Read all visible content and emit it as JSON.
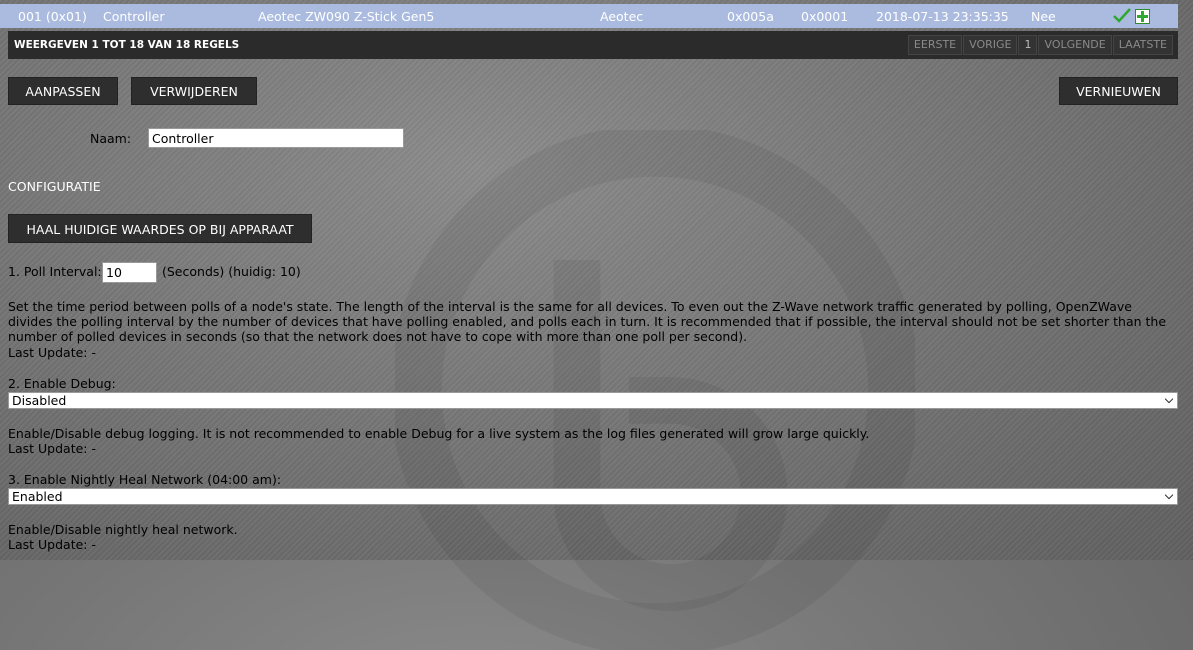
{
  "selected_row": {
    "node_id": "001 (0x01)",
    "name": "Controller",
    "description": "Aeotec ZW090 Z-Stick Gen5",
    "manufacturer": "Aeotec",
    "product_id": "0x005a",
    "product_type": "0x0001",
    "last_seen": "2018-07-13 23:35:35",
    "state": "Nee"
  },
  "table_footer": {
    "info": "WEERGEVEN 1 TOT 18 VAN 18 REGELS",
    "pager": {
      "first": "EERSTE",
      "previous": "VORIGE",
      "current": "1",
      "next": "VOLGENDE",
      "last": "LAATSTE"
    }
  },
  "actions": {
    "edit": "AANPASSEN",
    "delete": "VERWIJDEREN",
    "refresh": "VERNIEUWEN"
  },
  "name_field": {
    "label": "Naam:",
    "value": "Controller"
  },
  "config": {
    "title": "CONFIGURATIE",
    "fetch_button": "HAAL HUIDIGE WAARDES OP BIJ APPARAAT",
    "items": [
      {
        "label": "1. Poll Interval:",
        "value": "10",
        "unit": "(Seconds) (huidig: 10)",
        "description": "Set the time period between polls of a node's state. The length of the interval is the same for all devices. To even out the Z-Wave network traffic generated by polling, OpenZWave divides the polling interval by the number of devices that have polling enabled, and polls each in turn. It is recommended that if possible, the interval should not be set shorter than the number of polled devices in seconds (so that the network does not have to cope with more than one poll per second).",
        "last_update": "Last Update: -"
      },
      {
        "label": "2. Enable Debug:",
        "value": "Disabled",
        "description": "Enable/Disable debug logging. It is not recommended to enable Debug for a live system as the log files generated will grow large quickly.",
        "last_update": "Last Update: -"
      },
      {
        "label": "3. Enable Nightly Heal Network (04:00 am):",
        "value": "Enabled",
        "description": "Enable/Disable nightly heal network.",
        "last_update": "Last Update: -"
      }
    ]
  },
  "icons": {
    "ok": "checkmark-icon",
    "add": "plus-icon"
  }
}
